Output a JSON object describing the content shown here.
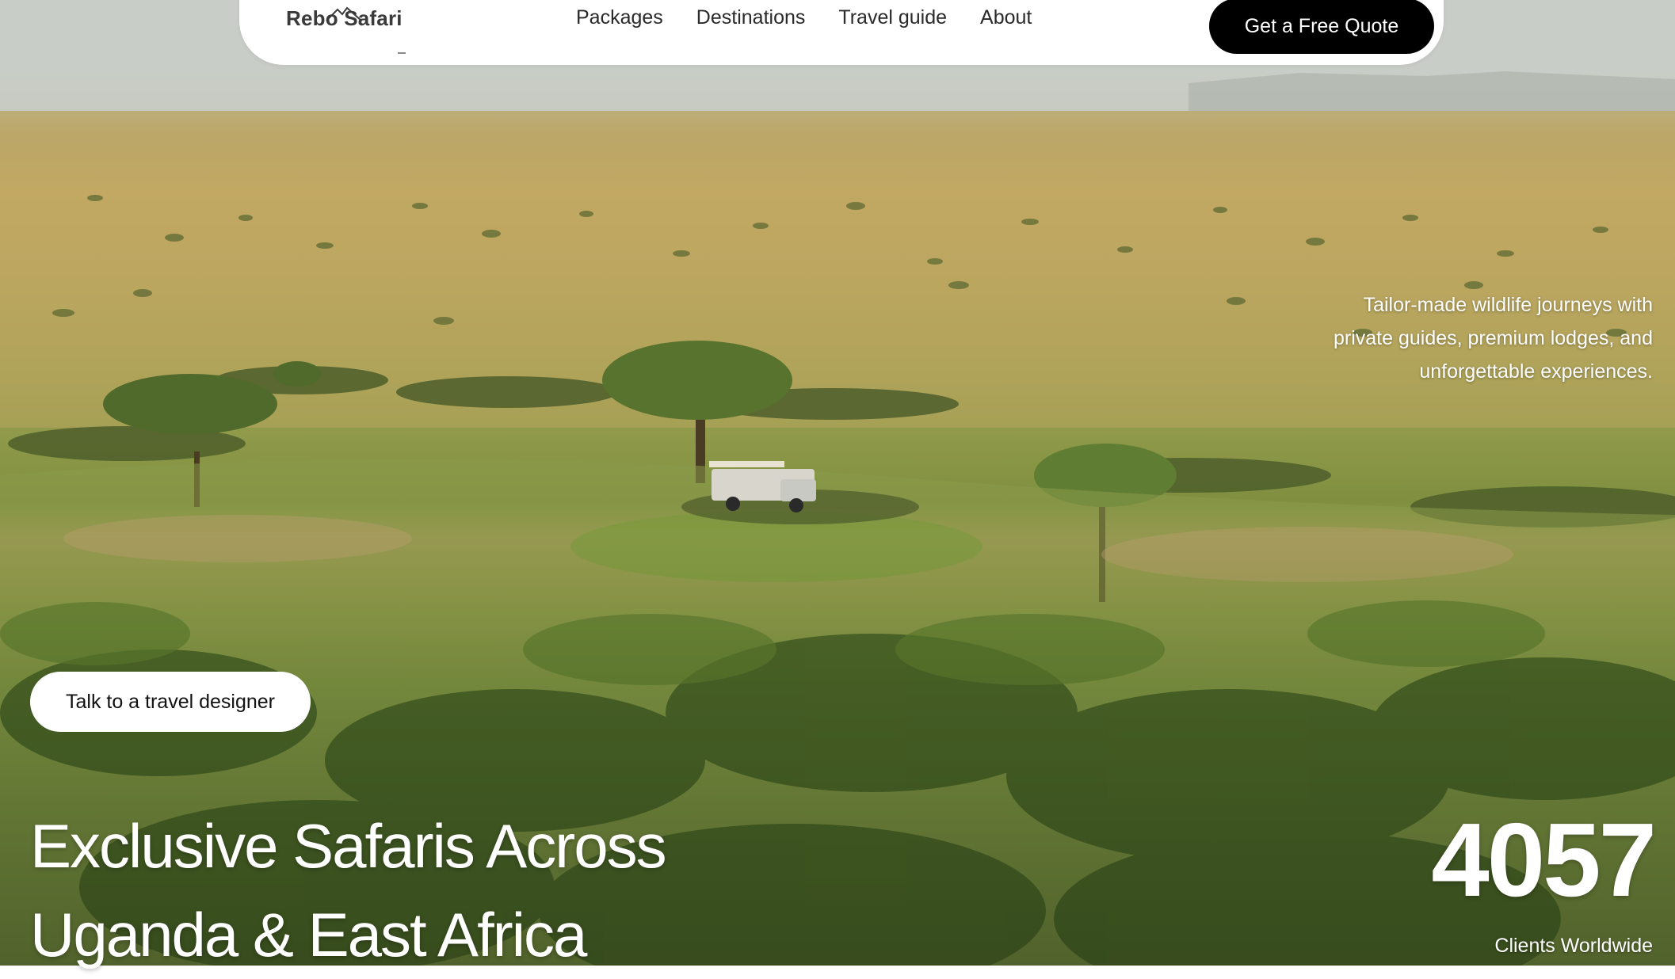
{
  "nav": {
    "logo_text": "Rebo Safari",
    "links": [
      "Packages",
      "Destinations",
      "Travel guide",
      "About"
    ],
    "cta_label": "Get a Free Quote"
  },
  "hero": {
    "tagline": "Tailor-made wildlife journeys with private guides, premium lodges, and unforgettable experiences.",
    "talk_button_label": "Talk to a travel designer",
    "headline_line1": "Exclusive Safaris Across",
    "headline_line2": "Uganda & East Africa",
    "stat_value": "4057",
    "stat_label": "Clients Worldwide"
  },
  "colors": {
    "cta_background": "#000000",
    "cta_text": "#ffffff",
    "navbar_background": "#ffffff",
    "hero_text": "#ffffff"
  },
  "icons": {
    "logo_mark": "mountain-roof-icon"
  }
}
